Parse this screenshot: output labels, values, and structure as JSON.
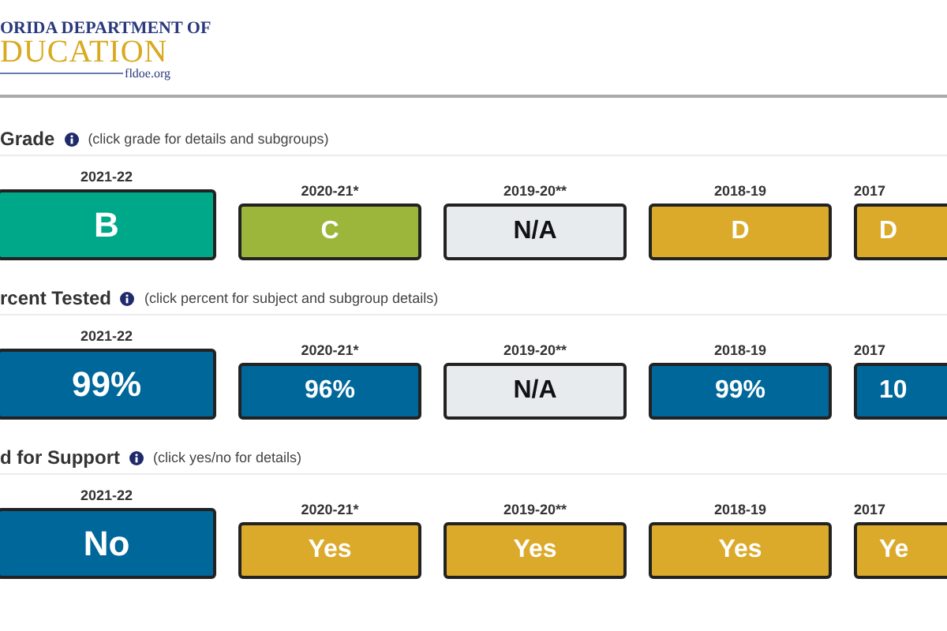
{
  "logo": {
    "line_1": "ORIDA DEPARTMENT OF",
    "line_2": "DUCATION",
    "site": "fldoe.org"
  },
  "sections": [
    {
      "title": "Grade",
      "hint": "(click grade for details and subgroups)",
      "items": [
        {
          "year": "2021-22",
          "value": "B",
          "color": "#00a88a",
          "kind": "value"
        },
        {
          "year": "2020-21*",
          "value": "C",
          "color": "#9cb63c",
          "kind": "value"
        },
        {
          "year": "2019-20**",
          "value": "N/A",
          "color": "#e8ebee",
          "kind": "na"
        },
        {
          "year": "2018-19",
          "value": "D",
          "color": "#dbaa2a",
          "kind": "value"
        },
        {
          "year": "2017",
          "value": "D",
          "color": "#dbaa2a",
          "kind": "value"
        }
      ]
    },
    {
      "title": "rcent Tested",
      "hint": "(click percent for subject and subgroup details)",
      "items": [
        {
          "year": "2021-22",
          "value": "99%",
          "color": "#00679b",
          "kind": "value"
        },
        {
          "year": "2020-21*",
          "value": "96%",
          "color": "#00679b",
          "kind": "value"
        },
        {
          "year": "2019-20**",
          "value": "N/A",
          "color": "#e8ebee",
          "kind": "na"
        },
        {
          "year": "2018-19",
          "value": "99%",
          "color": "#00679b",
          "kind": "value"
        },
        {
          "year": "2017",
          "value": "10",
          "color": "#00679b",
          "kind": "value"
        }
      ]
    },
    {
      "title": "d for Support",
      "hint": "(click yes/no for details)",
      "items": [
        {
          "year": "2021-22",
          "value": "No",
          "color": "#00679b",
          "kind": "value"
        },
        {
          "year": "2020-21*",
          "value": "Yes",
          "color": "#dbaa2a",
          "kind": "value"
        },
        {
          "year": "2019-20**",
          "value": "Yes",
          "color": "#dbaa2a",
          "kind": "value"
        },
        {
          "year": "2018-19",
          "value": "Yes",
          "color": "#dbaa2a",
          "kind": "value"
        },
        {
          "year": "2017",
          "value": "Ye",
          "color": "#dbaa2a",
          "kind": "value"
        }
      ]
    }
  ]
}
